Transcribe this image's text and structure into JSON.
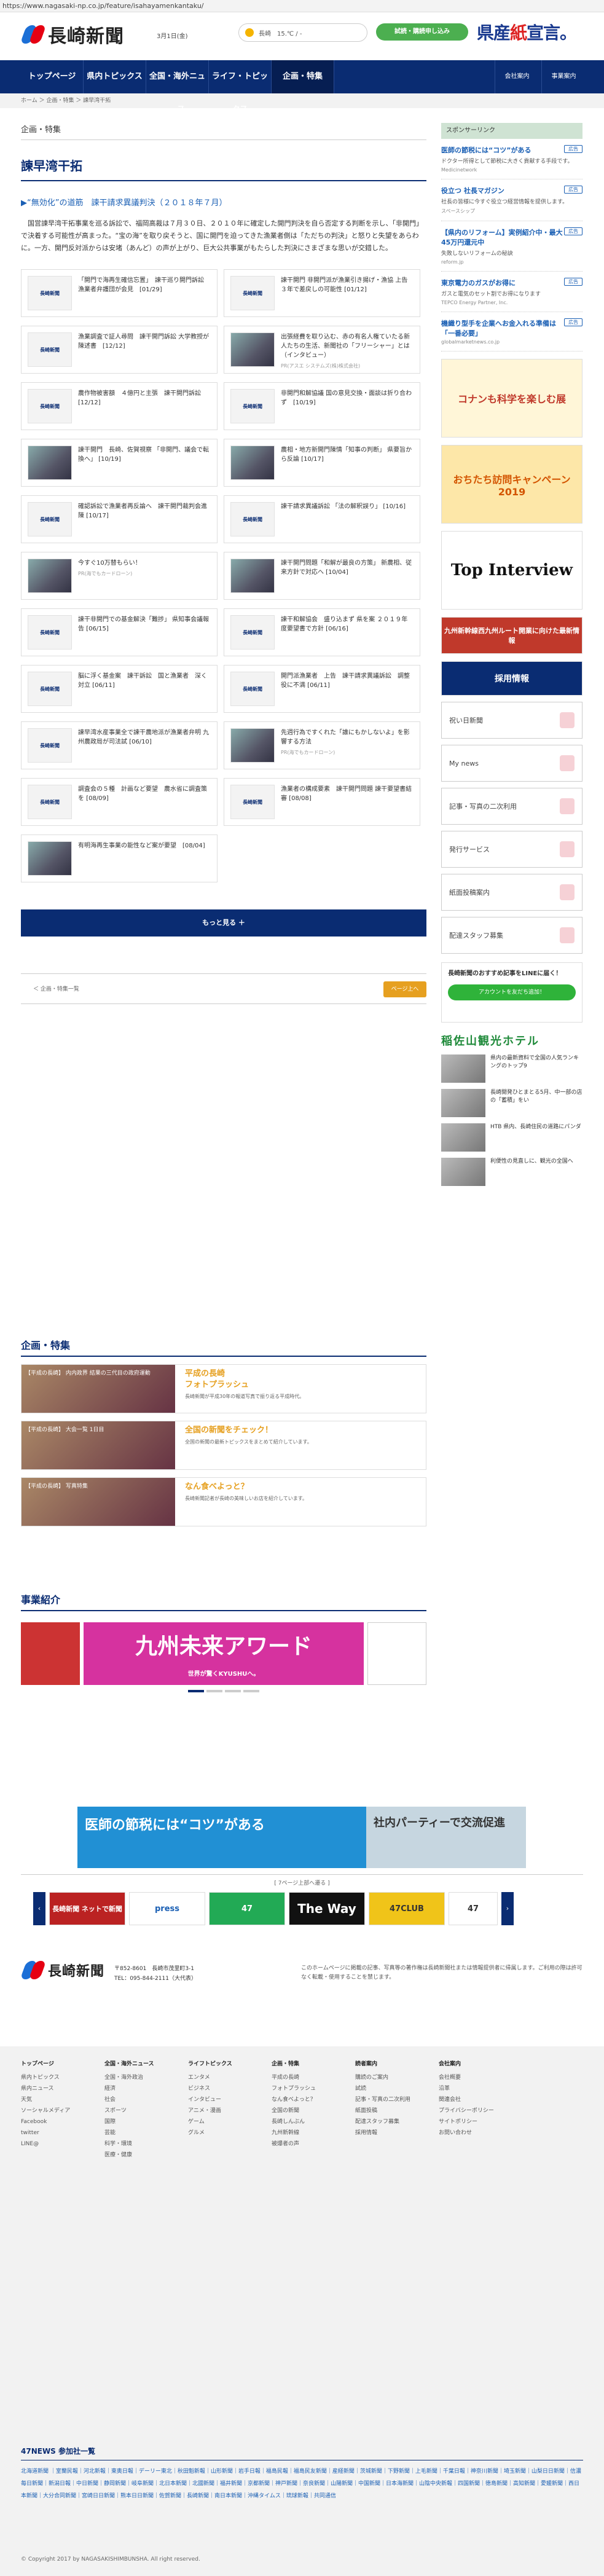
{
  "url": "https://www.nagasaki-np.co.jp/feature/isahayamenkantaku/",
  "header": {
    "logo_text": "長崎新聞",
    "date": "3月1日(金)",
    "weather": "長崎　15.℃ / -",
    "subscribe_label": "試読・購読申し込み",
    "ad_text_1": "県産",
    "ad_text_2": "紙",
    "ad_text_3": "宣言。"
  },
  "nav": {
    "items": [
      {
        "label": "トップページ"
      },
      {
        "label": "県内トピックス"
      },
      {
        "label": "全国・海外ニュース"
      },
      {
        "label": "ライフ・トピックス"
      },
      {
        "label": "企画・特集"
      }
    ],
    "right": [
      {
        "label": "会社案内"
      },
      {
        "label": "事業案内"
      }
    ]
  },
  "breadcrumb": "ホーム ＞ 企画・特集 ＞ 諫早湾干拓",
  "main": {
    "section_label": "企画・特集",
    "page_title": "諫早湾干拓",
    "head_link": "▶“無効化”の道筋　諫干請求異議判決（２０１８年７月）",
    "lead": "　国営諫早湾干拓事業を巡る訴訟で、福岡高裁は７月３０日、２０１０年に確定した開門判決を自ら否定する判断を示し、「非開門」で決着する可能性が高まった。“宝の海”を取り戻そうと、国に開門を迫ってきた漁業者側は「ただちの判決」と怒りと失望をあらわに。一方、開門反対派からは安堵（あんど）の声が上がり、巨大公共事業がもたらした判決にさまざまな思いが交錯した。",
    "cards": [
      {
        "text": "「開門で海再生確信忘置」　諫干巡り開門訴訟　漁業者弁護団が会見　[01/29]",
        "thumb": "長崎新聞",
        "photo": false,
        "pr": ""
      },
      {
        "text": "諫干開門 非開門派が漁業引き揚げ・漁協 上告３年で差戻しの可能性 [01/12]",
        "thumb": "長崎新聞",
        "photo": false,
        "pr": ""
      },
      {
        "text": "漁業調査で証人尋問　諫干開門訴訟 大学教授が陳述書　[12/12]",
        "thumb": "長崎新聞",
        "photo": false,
        "pr": ""
      },
      {
        "text": "出張経費を取り込む、赤の有名人権ていたる新人たちの生活、新聞社の「フリーシャー」とは（インタビュー）",
        "thumb": "",
        "photo": true,
        "pr": "PR(アスエ システムズ(株)株式会社)"
      },
      {
        "text": "農作物被害額　４億円と主張　諫干開門訴訟　[12/12]",
        "thumb": "長崎新聞",
        "photo": false,
        "pr": ""
      },
      {
        "text": "非開門和解協議 国の意見交換・面談は折り合わず　[10/19]",
        "thumb": "長崎新聞",
        "photo": false,
        "pr": ""
      },
      {
        "text": "諫干開門　長崎、佐賀視察 「非開門、議会で転換へ」 [10/19]",
        "thumb": "",
        "photo": true,
        "pr": ""
      },
      {
        "text": "農相・地方新開門陳情「知事の判断」 県要旨から反論 [10/17]",
        "thumb": "",
        "photo": true,
        "pr": ""
      },
      {
        "text": "確認訴訟で漁業者再反論へ　諫干開門裁判会進陳 [10/17]",
        "thumb": "長崎新聞",
        "photo": false,
        "pr": ""
      },
      {
        "text": "諫干請求異議訴訟 「法の解釈誤り」 [10/16]",
        "thumb": "長崎新聞",
        "photo": false,
        "pr": ""
      },
      {
        "text": "今すぐ10万替もらい！",
        "thumb": "",
        "photo": true,
        "pr": "PR(海でもカードローン)"
      },
      {
        "text": "諫干開門問題「和解が最良の方策」 新農相、従来方針で対応へ [10/04]",
        "thumb": "",
        "photo": true,
        "pr": ""
      },
      {
        "text": "諫干非開門での基金解決「難捗」 県知事会議報告 [06/15]",
        "thumb": "長崎新聞",
        "photo": false,
        "pr": ""
      },
      {
        "text": "諫干和解協会　盛り込まず 県を案 ２０１９年度要望書で方針 [06/16]",
        "thumb": "長崎新聞",
        "photo": false,
        "pr": ""
      },
      {
        "text": "脳に浮く基金案　諫干訴訟　国と漁業者　深く対立 [06/11]",
        "thumb": "長崎新聞",
        "photo": false,
        "pr": ""
      },
      {
        "text": "開門派漁業者　上告　諫干請求異議訴訟　調整役に不満 [06/11]",
        "thumb": "長崎新聞",
        "photo": false,
        "pr": ""
      },
      {
        "text": "諫早湾水産事業全で諫干農地派が漁業者弁明 九州農政局が司法試 [06/10]",
        "thumb": "長崎新聞",
        "photo": false,
        "pr": ""
      },
      {
        "text": "先週行為ですくれた「誰にもかしないよ」を影響する方法",
        "thumb": "",
        "photo": true,
        "pr": "PR(海でもカードローン)"
      },
      {
        "text": "調査会の５種　計画など要望　農水省に調査策を [08/09]",
        "thumb": "長崎新聞",
        "photo": false,
        "pr": ""
      },
      {
        "text": "漁業者の構成要素　諫干開門問題 諫干要望書結審 [08/08]",
        "thumb": "長崎新聞",
        "photo": false,
        "pr": ""
      },
      {
        "text": "有明海再生事業の能性など案が要望　[08/04]",
        "thumb": "",
        "photo": true,
        "pr": ""
      }
    ],
    "more_label": "もっと見る ＋",
    "pager_prev": "＜ 企画・特集一覧",
    "pager_next": "ページ上へ"
  },
  "sidebar": {
    "sponsor_header": "スポンサーリンク",
    "sponsors": [
      {
        "badge": "広告",
        "title": "医師の節税には“コツ”がある",
        "desc": "ドクター所得として節税に大きく貢献する手段です。",
        "src": "Medicinetwork"
      },
      {
        "badge": "広告",
        "title": "役立つ 社長マガジン",
        "desc": "社長の皆様に今すぐ役立つ経営情報を提供します。",
        "src": "スペースシップ"
      },
      {
        "badge": "広告",
        "title": "【県内のリフォーム】実例紹介中・最大45万円還元中",
        "desc": "失敗しないリフォームの秘訣",
        "src": "reform.jp"
      },
      {
        "badge": "広告",
        "title": "東京電力のガスがお得に",
        "desc": "ガスと電気のセット割でお得になります",
        "src": "TEPCO Energy Partner, Inc."
      },
      {
        "badge": "広告",
        "title": "機織り型手を企業へお金入れる準備は「一番必要」",
        "desc": "",
        "src": "globalmarketnews.co.jp"
      }
    ],
    "ads": [
      {
        "text": "コナンも科学を楽しむ展"
      },
      {
        "text": "おちたち訪問キャンペーン2019"
      },
      {
        "text": "Top Interview"
      },
      {
        "text": "九州新幹線西九州ルート開業に向けた最新情報"
      },
      {
        "text": "採用情報"
      }
    ],
    "menu": [
      {
        "label": "祝い日新聞"
      },
      {
        "label": "My news"
      },
      {
        "label": "記事・写真の二次利用"
      },
      {
        "label": "発行サービス"
      },
      {
        "label": "紙面投稿案内"
      },
      {
        "label": "配達スタッフ募集"
      }
    ],
    "line_title": "長崎新聞のおすすめ記事をLINEに届く！",
    "line_button": "アカウントを友だち追加！",
    "hotel_name": "稲佐山観光ホテル",
    "rank": [
      {
        "text": "県内の最新資料で全国の人気ランキングのトップ9"
      },
      {
        "text": "長崎開発ひとまとる5月、中一部の店の「蓄積」をい"
      },
      {
        "text": "HTB 県内、長崎住民の道路にパンダ"
      },
      {
        "text": "利便性の見直しに、観光の全国へ"
      }
    ]
  },
  "features": {
    "title": "企画・特集",
    "rows": [
      {
        "caption": "【平成の長崎】 内内政界 結果の三代目の政府運動",
        "title": "平成の長崎\nフォトプラッシュ",
        "desc": "長崎新聞が平成30年の報道写真で振り返る平成時代。"
      },
      {
        "caption": "【平成の長崎】 大会一覧 1日目",
        "title": "全国の新聞をチェック！",
        "desc": "全国の新聞の最新トピックスをまとめて紹介しています。"
      },
      {
        "caption": "【平成の長崎】 写真特集",
        "title": "なん食べよっと？",
        "desc": "長崎新聞記者が長崎の美味しいお店を紹介しています。"
      }
    ]
  },
  "business": {
    "title": "事業紹介",
    "banner_title": "九州未来アワード",
    "banner_sub": "世界が驚くKYUSHUへ。"
  },
  "bottom_ad": {
    "left": "医師の節税には“コツ”がある",
    "right": "社内パーティーで交流促進"
  },
  "partners": {
    "header": "[ 7ページ上部へ遷る ]",
    "logos": [
      {
        "label": "長崎新聞 ネットで新聞"
      },
      {
        "label": "press"
      },
      {
        "label": "47"
      },
      {
        "label": "The Way"
      },
      {
        "label": "47CLUB"
      },
      {
        "label": "47"
      }
    ]
  },
  "footer": {
    "logo_text": "長崎新聞",
    "address": "〒852-8601　長崎市茂里町3-1",
    "tel": "TEL：095-844-2111（大代表）",
    "notice": "このホームページに掲載の記事、写真等の著作権は長崎新聞社または情報提供者に帰属します。ご利用の際は許可なく転載・使用することを禁じます。",
    "cols": [
      {
        "title": "トップページ",
        "items": [
          "県内トピックス",
          "県内ニュース",
          "天気",
          "ソーシャルメディア",
          "Facebook",
          "twitter",
          "LINE@"
        ]
      },
      {
        "title": "全国・海外ニュース",
        "items": [
          "全国・海外政治",
          "経済",
          "社会",
          "スポーツ",
          "国際",
          "芸能",
          "科学・環境",
          "医療・健康"
        ]
      },
      {
        "title": "ライフトピックス",
        "items": [
          "エンタメ",
          "ビジネス",
          "インタビュー",
          "アニメ・漫画",
          "ゲーム",
          "グルメ"
        ]
      },
      {
        "title": "企画・特集",
        "items": [
          "平成の長崎",
          "フォトプラッシュ",
          "なん食べよっと？",
          "全国の新聞",
          "長崎しんぶん",
          "九州新幹線",
          "被爆者の声"
        ]
      },
      {
        "title": "読者案内",
        "items": [
          "購読のご案内",
          "試読",
          "記事・写真の二次利用",
          "紙面投稿",
          "配達スタッフ募集",
          "採用情報"
        ]
      },
      {
        "title": "会社案内",
        "items": [
          "会社概要",
          "沿革",
          "関連会社",
          "プライバシーポリシー",
          "サイトポリシー",
          "お問い合わせ"
        ]
      }
    ],
    "f47_title": "47NEWS 参加社一覧",
    "f47_text": "北海道新聞 ｜室蘭民報｜河北新報｜東奥日報｜デーリー東北｜秋田魁新報｜山形新聞｜岩手日報｜福島民報｜福島民友新聞｜産経新聞｜茨城新聞｜下野新聞｜上毛新聞｜千葉日報｜神奈川新聞｜埼玉新聞｜山梨日日新聞｜信濃毎日新聞｜新潟日報｜中日新聞｜静岡新聞｜岐阜新聞｜北日本新聞｜北國新聞｜福井新聞｜京都新聞｜神戸新聞｜奈良新聞｜山陽新聞｜中国新聞｜日本海新聞｜山陰中央新報｜四国新聞｜徳島新聞｜高知新聞｜愛媛新聞｜西日本新聞｜大分合同新聞｜宮崎日日新聞｜熊本日日新聞｜佐賀新聞｜長崎新聞｜南日本新聞｜沖縄タイムス｜琉球新報｜共同通信",
    "copyright": "© Copyright 2017 by NAGASAKISHIMBUNSHA. All right reserved."
  },
  "colors": {
    "brand_navy": "#0a2c72",
    "brand_red": "#e60012",
    "brand_blue": "#1c6fd6",
    "accent_orange": "#e6a020",
    "line_green": "#2fb33a"
  }
}
